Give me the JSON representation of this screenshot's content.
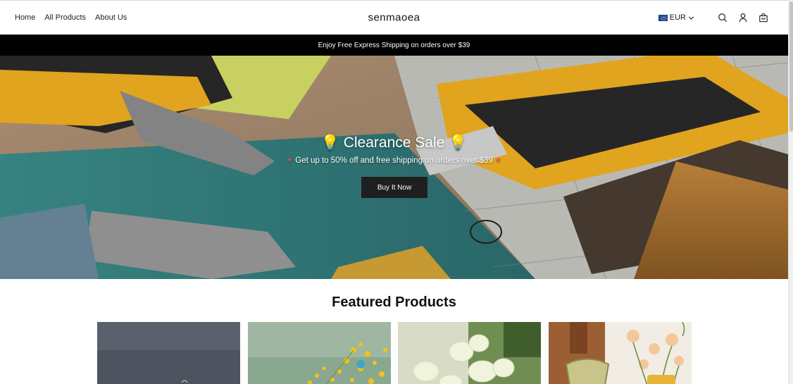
{
  "nav": {
    "items": [
      {
        "label": "Home"
      },
      {
        "label": "All Products"
      },
      {
        "label": "About Us"
      }
    ]
  },
  "brand": "senmaoea",
  "currency": {
    "code": "EUR",
    "flag": "eu-flag-icon"
  },
  "header_icons": [
    "search-icon",
    "account-icon",
    "cart-icon"
  ],
  "announcement": "Enjoy Free Express Shipping on orders over $39",
  "hero": {
    "title": "Clearance Sale",
    "title_emoji": "💡",
    "subtitle": "Get up to 50% off and free shipping on orders over $39",
    "subtitle_emoji": "✴",
    "button": "Buy It Now"
  },
  "featured": {
    "title": "Featured Products",
    "products": [
      {
        "image": "product-image-dark"
      },
      {
        "image": "product-image-yellow-flowers"
      },
      {
        "image": "product-image-white-roses"
      },
      {
        "image": "product-image-flower-vase"
      }
    ]
  },
  "colors": {
    "announcement_bg": "#000000",
    "button_bg": "#1f1f1f",
    "text": "#1a1a1a"
  }
}
